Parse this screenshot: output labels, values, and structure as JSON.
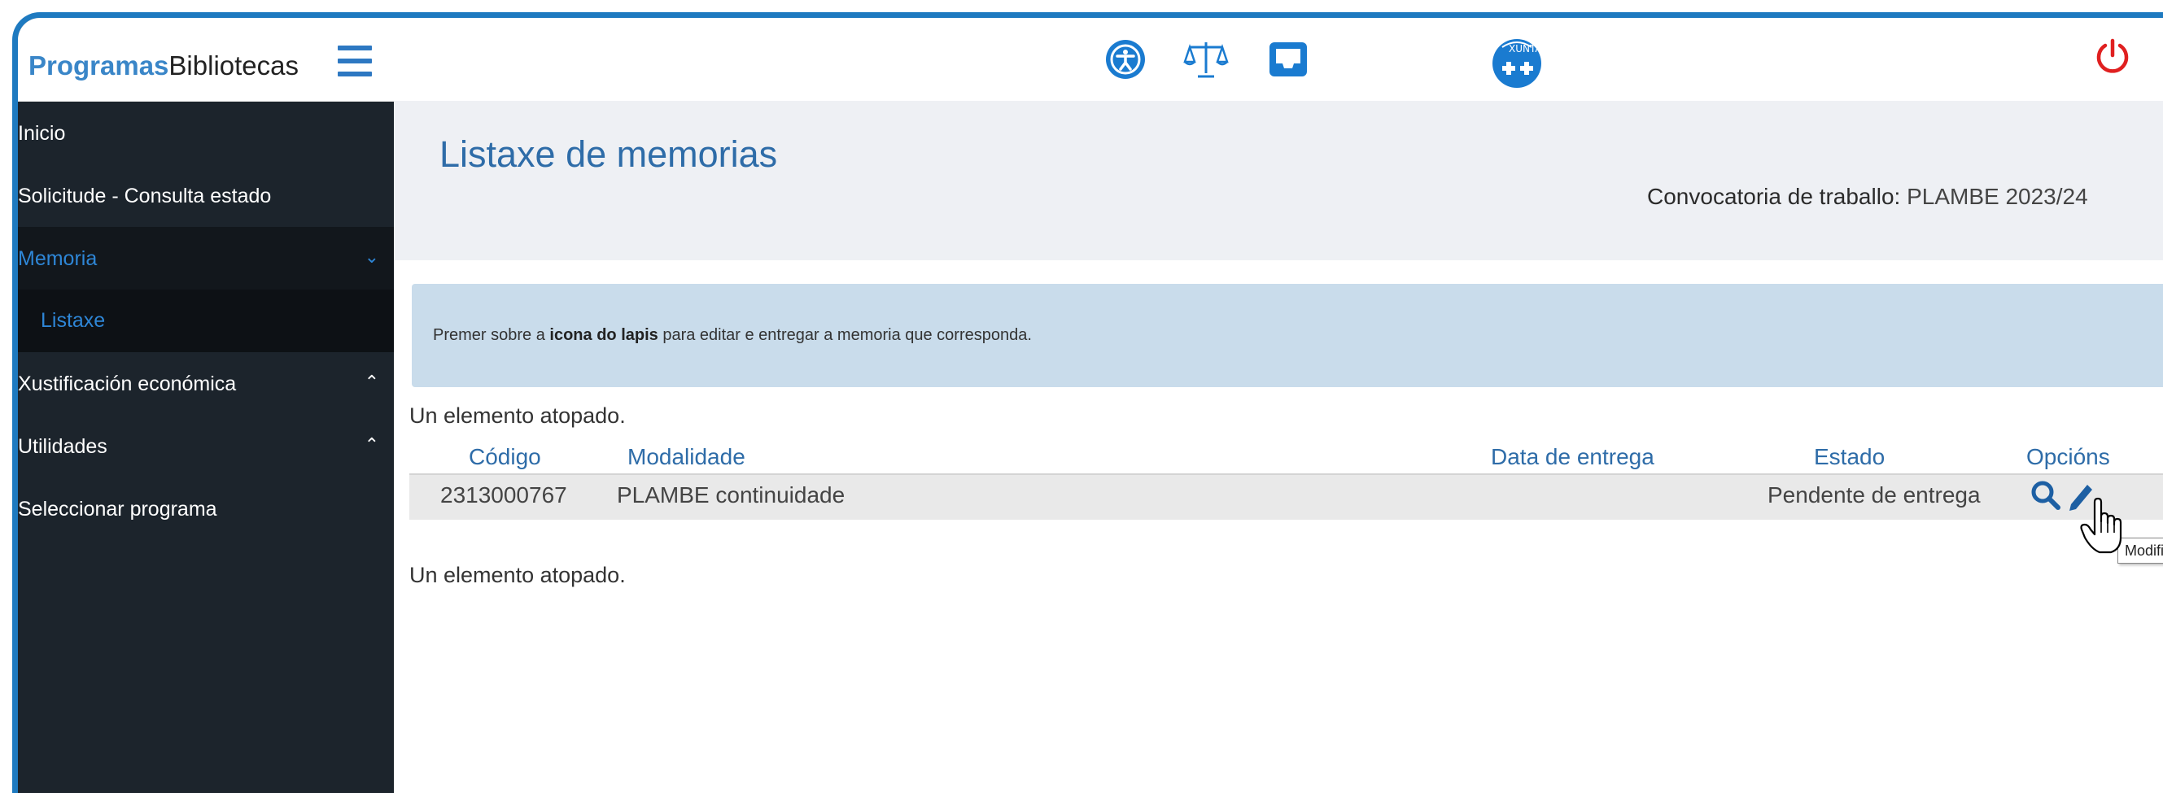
{
  "brand": {
    "accent": "Programas",
    "rest": "Bibliotecas"
  },
  "sidebar": {
    "items": [
      {
        "label": "Inicio"
      },
      {
        "label": "Solicitude - Consulta estado"
      },
      {
        "label": "Memoria",
        "chevron": "chevron-down"
      },
      {
        "label": "Listaxe"
      },
      {
        "label": "Xustificación económica",
        "chevron": "chevron-up"
      },
      {
        "label": "Utilidades",
        "chevron": "chevron-up"
      },
      {
        "label": "Seleccionar programa"
      }
    ]
  },
  "topbar": {
    "icons": [
      "accessibility-icon",
      "justice-scale-icon",
      "inbox-icon",
      "xunta-health-logo-icon",
      "power-icon"
    ]
  },
  "main": {
    "title": "Listaxe de memorias",
    "convocatoria_label": "Convocatoria de traballo:",
    "convocatoria_value": "PLAMBE 2023/24",
    "info": {
      "prefix": "Premer sobre a",
      "bold": "icona do lapis",
      "suffix": "para editar e entregar a memoria que corresponda."
    },
    "count_text": "Un elemento atopado.",
    "table": {
      "headers": [
        "Código",
        "Modalidade",
        "Data de entrega",
        "Estado",
        "Opcións"
      ],
      "rows": [
        {
          "codigo": "2313000767",
          "modalidade": "PLAMBE continuidade",
          "data": "",
          "estado": "Pendente de entrega"
        }
      ]
    },
    "tooltip": "Modifi"
  },
  "colors": {
    "accent": "#2e6ca8",
    "sidebar_bg": "#1c242c",
    "power": "#e02020"
  }
}
